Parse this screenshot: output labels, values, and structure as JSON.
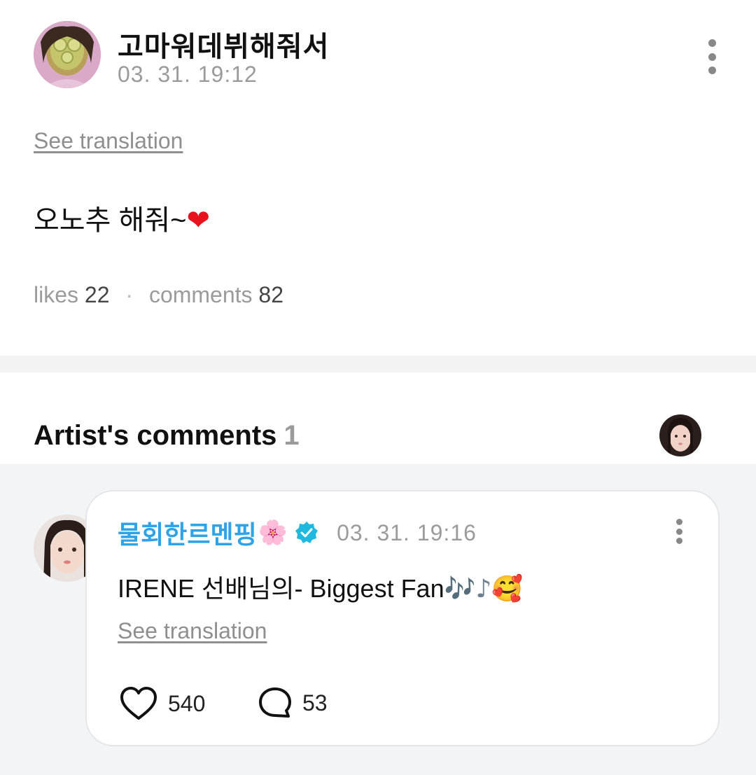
{
  "post": {
    "author": "고마워데뷔해줘서",
    "timestamp": "03. 31. 19:12",
    "see_translation": "See translation",
    "text": "오노추 해줘~",
    "text_emoji": "❤",
    "likes_label": "likes",
    "likes_count": "22",
    "separator": "·",
    "comments_label": "comments",
    "comments_count": "82"
  },
  "artist_comments": {
    "title": "Artist's comments",
    "count": "1"
  },
  "comment": {
    "author": "물회한르멘핑",
    "author_emoji": "🌸",
    "timestamp": "03. 31. 19:16",
    "text": "IRENE 선배님의- Biggest Fan",
    "text_notes": "🎶♪",
    "text_emoji": "🥰",
    "see_translation": "See translation",
    "like_count": "540",
    "reply_count": "53"
  },
  "colors": {
    "accent_name": "#2fa3e8",
    "verified_badge": "#1fb9e0",
    "heart": "#e8121f",
    "muted_text": "#9b9b9b",
    "section_bg": "#f3f4f6"
  },
  "icons": {
    "post_menu": "more-vertical-icon",
    "comment_menu": "more-vertical-icon",
    "verified": "verified-badge-icon",
    "like": "heart-outline-icon",
    "reply": "speech-bubble-icon"
  }
}
